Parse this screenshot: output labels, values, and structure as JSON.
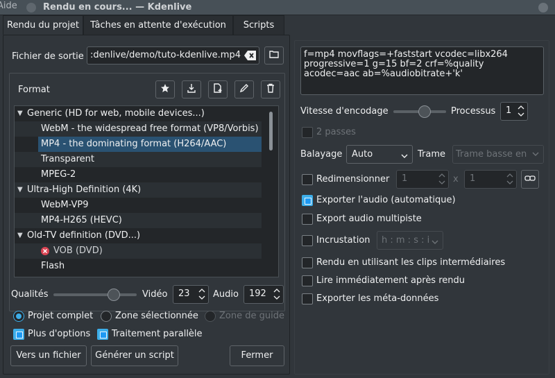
{
  "window": {
    "title": "Rendu en cours... — Kdenlive",
    "menu_fragment": "Aide"
  },
  "tabs": [
    {
      "label": "Rendu du projet"
    },
    {
      "label": "Tâches en attente d'exécution"
    },
    {
      "label": "Scripts"
    }
  ],
  "output": {
    "label": "Fichier de sortie",
    "value": ":denlive/demo/tuto-kdenlive.mp4"
  },
  "format": {
    "label": "Format",
    "groups": [
      {
        "name": "Generic (HD for web, mobile devices...)",
        "items": [
          "WebM - the widespread free format (VP8/Vorbis)",
          "MP4 - the dominating format (H264/AAC)",
          "Transparent",
          "MPEG-2"
        ]
      },
      {
        "name": "Ultra-High Definition (4K)",
        "items": [
          "WebM-VP9",
          "MP4-H265 (HEVC)"
        ]
      },
      {
        "name": "Old-TV definition (DVD...)",
        "items": [
          "VOB (DVD)",
          "Flash"
        ]
      }
    ],
    "selected": "MP4 - the dominating format (H264/AAC)"
  },
  "quality": {
    "label": "Qualités",
    "video_label": "Vidéo",
    "video_value": "23",
    "audio_label": "Audio",
    "audio_value": "192"
  },
  "range": {
    "full": "Projet complet",
    "zone": "Zone sélectionnée",
    "guide": "Zone de guide"
  },
  "options": {
    "more": "Plus d'options",
    "parallel": "Traitement parallèle"
  },
  "buttons": {
    "to_file": "Vers un fichier",
    "script": "Générer un script",
    "close": "Fermer"
  },
  "params": {
    "text": "f=mp4 movflags=+faststart vcodec=libx264 progressive=1 g=15 bf=2 crf=%quality acodec=aac ab=%audiobitrate+'k'"
  },
  "encoding": {
    "speed_label": "Vitesse d'encodage",
    "threads_label": "Processus",
    "threads_value": "1"
  },
  "two_pass": "2 passes",
  "scan": {
    "label": "Balayage",
    "value": "Auto",
    "field_label": "Trame",
    "field_value": "Trame basse en premier"
  },
  "resize": {
    "label": "Redimensionner",
    "w": "1",
    "x": "x",
    "h": "1"
  },
  "audio_export": "Exporter l'audio (automatique)",
  "multitrack": "Export audio multipiste",
  "timecode": {
    "label": "Incrustation",
    "value": "h : m : s : i"
  },
  "proxy": "Rendu en utilisant les clips intermédiaires",
  "play_after": "Lire immédiatement après rendu",
  "metadata": "Exporter les méta-données",
  "colors": {
    "bg": "#31363b",
    "accent": "#3daee9",
    "selection": "#2a5272",
    "error": "#da4453"
  }
}
